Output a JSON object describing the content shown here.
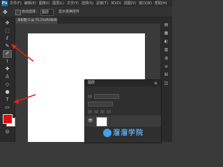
{
  "app": {
    "logo_text": "Ps"
  },
  "menu": [
    "文件(F)",
    "编辑(E)",
    "图像(I)",
    "图层(L)",
    "文字(Y)",
    "选择(S)",
    "滤镜(T)",
    "3D(D)",
    "视图(V)",
    "窗口(W)",
    "帮助(H)"
  ],
  "options_bar": {
    "auto_select_label": "自动选择：",
    "auto_select_value": "图层",
    "transform_label": "显示变换控件"
  },
  "document_tab": {
    "label": "未标题-1 @ 75.1%(RGB/8)"
  },
  "toolbar": {
    "tools": [
      "move-tool",
      "marquee-tool",
      "lasso-tool",
      "quick-select-tool",
      "crop-tool",
      "eyedropper-tool",
      "healing-brush-tool",
      "brush-tool",
      "clone-stamp-tool",
      "history-brush-tool",
      "eraser-tool",
      "gradient-tool",
      "blur-tool",
      "dodge-tool",
      "pen-tool",
      "type-tool",
      "path-select-tool",
      "shape-tool",
      "hand-tool",
      "zoom-tool"
    ],
    "active_tool": "brush-tool",
    "foreground_color": "#e01010",
    "background_color": "#ffffff"
  },
  "layers_panel": {
    "title": "图层",
    "layer_visible": true
  },
  "watermark": {
    "text": "溜溜学院"
  },
  "colors": {
    "accent_arrow": "#e02020",
    "canvas": "#ffffff",
    "workspace": "#3a3a3a"
  }
}
